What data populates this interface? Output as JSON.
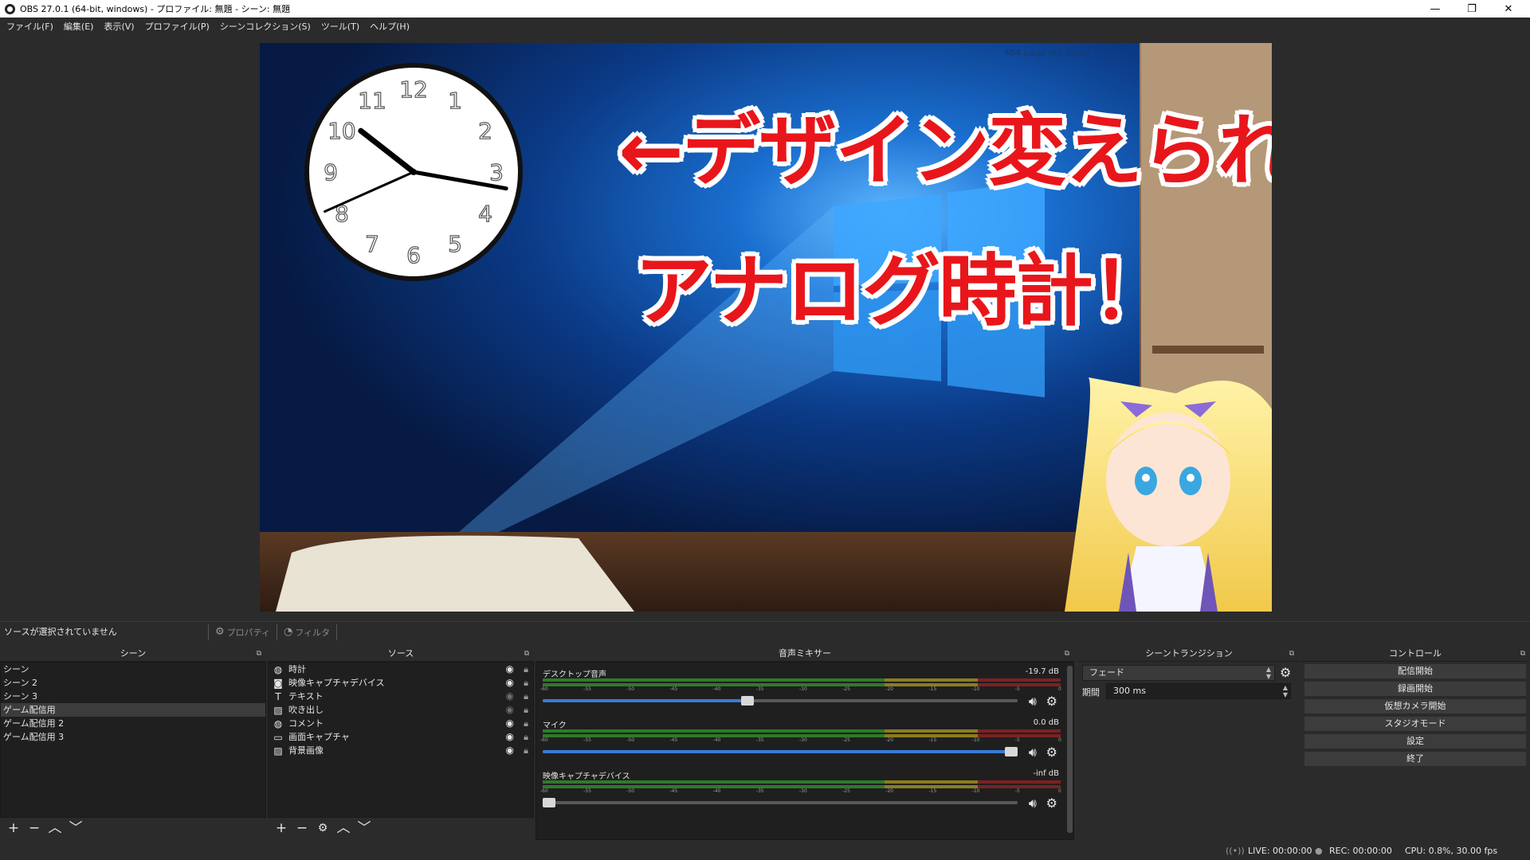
{
  "window": {
    "title": "OBS 27.0.1 (64-bit, windows) - プロファイル: 無題 - シーン: 無題",
    "minimize": "—",
    "restore": "❐",
    "close": "✕"
  },
  "menu": [
    "ファイル(F)",
    "編集(E)",
    "表示(V)",
    "プロファイル(P)",
    "シーンコレクション(S)",
    "ツール(T)",
    "ヘルプ(H)"
  ],
  "preview": {
    "overlay_line1": "←デザイン変えられる",
    "overlay_line2": "アナログ時計！",
    "browser_error": "404 page not found",
    "clock_numbers": [
      "12",
      "1",
      "2",
      "3",
      "4",
      "5",
      "6",
      "7",
      "8",
      "9",
      "10",
      "11"
    ],
    "clock_time": {
      "hour": 10,
      "minute": 16,
      "second": 41
    }
  },
  "context": {
    "no_source": "ソースが選択されていません",
    "properties": "プロパティ",
    "filters": "フィルタ"
  },
  "scenes": {
    "title": "シーン",
    "items": [
      "シーン",
      "シーン 2",
      "シーン 3",
      "ゲーム配信用",
      "ゲーム配信用 2",
      "ゲーム配信用 3"
    ],
    "selected_index": 3
  },
  "sources": {
    "title": "ソース",
    "items": [
      {
        "name": "時計",
        "icon": "globe-icon",
        "visible": true
      },
      {
        "name": "映像キャプチャデバイス",
        "icon": "camera-icon",
        "visible": true
      },
      {
        "name": "テキスト",
        "icon": "text-icon",
        "visible": false
      },
      {
        "name": "吹き出し",
        "icon": "image-icon",
        "visible": false
      },
      {
        "name": "コメント",
        "icon": "globe-icon",
        "visible": true
      },
      {
        "name": "画面キャプチャ",
        "icon": "monitor-icon",
        "visible": true
      },
      {
        "name": "背景画像",
        "icon": "image-icon",
        "visible": true
      }
    ]
  },
  "mixer": {
    "title": "音声ミキサー",
    "ticks": [
      "-60",
      "-55",
      "-50",
      "-45",
      "-40",
      "-35",
      "-30",
      "-25",
      "-20",
      "-15",
      "-10",
      "-5",
      "0"
    ],
    "channels": [
      {
        "name": "デスクトップ音声",
        "db": "-19.7 dB",
        "volume": 0.43
      },
      {
        "name": "マイク",
        "db": "0.0 dB",
        "volume": 1.0
      },
      {
        "name": "映像キャプチャデバイス",
        "db": "-inf dB",
        "volume": 0.0
      }
    ]
  },
  "transitions": {
    "title": "シーントランジション",
    "selected": "フェード",
    "duration_label": "期間",
    "duration_value": "300 ms"
  },
  "controls": {
    "title": "コントロール",
    "buttons": [
      "配信開始",
      "録画開始",
      "仮想カメラ開始",
      "スタジオモード",
      "設定",
      "終了"
    ]
  },
  "status": {
    "live": "LIVE: 00:00:00",
    "rec": "REC: 00:00:00",
    "cpu": "CPU: 0.8%, 30.00 fps"
  },
  "colors": {
    "accent_blue": "#3a7bd5",
    "overlay_red": "#e8161b",
    "panel_bg": "#2b2b2b",
    "list_bg": "#1f1f1f"
  }
}
